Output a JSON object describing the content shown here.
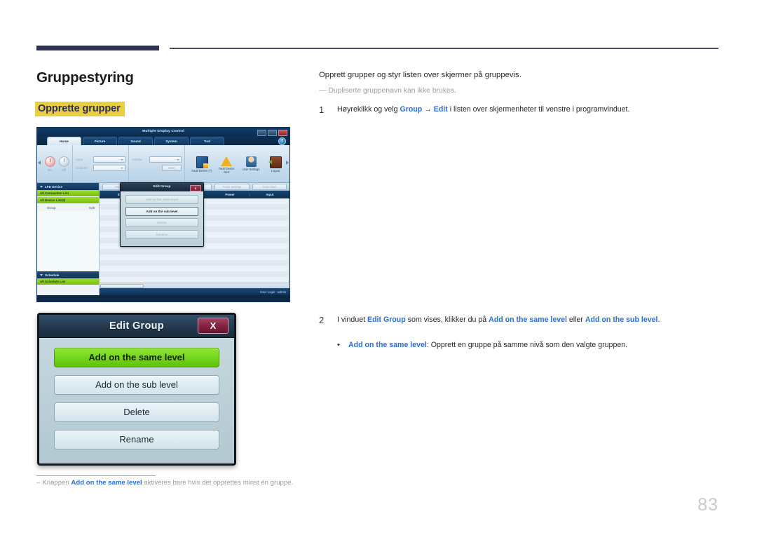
{
  "page": {
    "title": "Gruppestyring",
    "section_tag": "Opprette grupper",
    "page_number": "83"
  },
  "intro": {
    "lead": "Opprett grupper og styr listen over skjermer på gruppevis.",
    "note_dash": "―",
    "note": "Dupliserte gruppenavn kan ikke brukes."
  },
  "steps": [
    {
      "number": "1",
      "text_before": "Høyreklikk og velg ",
      "link1": "Group",
      "arrow": " → ",
      "link2": "Edit",
      "text_after": " i listen over skjermenheter til venstre i programvinduet."
    },
    {
      "number": "2",
      "text_before": "I vinduet ",
      "link1": "Edit Group",
      "mid": " som vises, klikker du på ",
      "link2": "Add on the same level",
      "mid2": " eller ",
      "link3": "Add on the sub level",
      "text_after": "."
    }
  ],
  "bullet": {
    "dot": "•",
    "term": "Add on the same level",
    "text": ": Opprett en gruppe på samme nivå som den valgte gruppen."
  },
  "footnote": {
    "dash": "–",
    "before": "Knappen ",
    "term": "Add on the same level",
    "after": " aktiveres bare hvis det opprettes minst én gruppe."
  },
  "dialog": {
    "title": "Edit Group",
    "close_label": "X",
    "buttons": [
      {
        "label": "Add on the same level",
        "state": "primary"
      },
      {
        "label": "Add on the sub level",
        "state": "normal"
      },
      {
        "label": "Delete",
        "state": "normal"
      },
      {
        "label": "Rename",
        "state": "normal"
      }
    ]
  },
  "mdc": {
    "window_title": "Multiple Display Control",
    "window_buttons": [
      "–",
      "❑",
      "✕"
    ],
    "help_label": "?",
    "tabs": [
      {
        "label": "Home",
        "active": true
      },
      {
        "label": "Picture",
        "active": false
      },
      {
        "label": "Sound",
        "active": false
      },
      {
        "label": "System",
        "active": false
      },
      {
        "label": "Tool",
        "active": false
      }
    ],
    "power": {
      "on_label": "On",
      "off_label": "Off"
    },
    "fields": [
      {
        "label": "Input"
      },
      {
        "label": "Channel"
      }
    ],
    "volume": {
      "label": "Volume",
      "mute_label": "Mute"
    },
    "ribbon_icons": [
      {
        "label": "Fault Device (?)",
        "icon": "monitor-fault-icon"
      },
      {
        "label": "Fault Device Alert",
        "icon": "warning-triangle-icon"
      },
      {
        "label": "User Settings",
        "icon": "user-settings-icon"
      },
      {
        "label": "Logout",
        "icon": "logout-door-icon"
      }
    ],
    "left_panel": {
      "device_header": "LFD Device",
      "all_connection_list": "All Connection List",
      "all_device_list": "All Device List(0)",
      "group_label": "Group",
      "group_edit": "Edit",
      "schedule_header": "Schedule",
      "all_schedule_list": "All Schedule List"
    },
    "toolbar_buttons": [
      "More...",
      "Delete",
      "Copy Settings",
      "Paste Settings",
      "Index Mail"
    ],
    "grid_columns": [
      "",
      "ID",
      "",
      "Power",
      "Input"
    ],
    "status": "User Login : admin",
    "mini_dialog": {
      "title": "Edit Group",
      "close_label": "x",
      "buttons": [
        {
          "label": "Add on the same level",
          "state": "disabled"
        },
        {
          "label": "Add on the sub level",
          "state": "enabled"
        },
        {
          "label": "Delete",
          "state": "disabled"
        },
        {
          "label": "Rename",
          "state": "disabled"
        }
      ]
    }
  },
  "colors": {
    "navy": "#2e3152",
    "highlight": "#e8ce43",
    "link_blue": "#2b6fd4",
    "dialog_green": "#7ddc22"
  }
}
